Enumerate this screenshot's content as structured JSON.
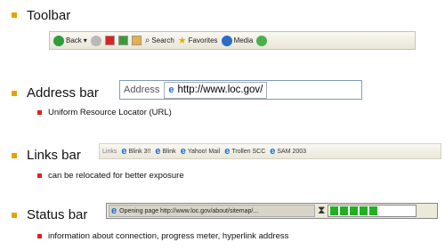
{
  "toolbar": {
    "heading": "Toolbar",
    "back_label": "Back",
    "search_label": "Search",
    "favorites_label": "Favorites",
    "media_label": "Media"
  },
  "address": {
    "heading": "Address bar",
    "label": "Address",
    "url": "http://www.loc.gov/",
    "description": "Uniform Resource Locator (URL)"
  },
  "links": {
    "heading": "Links bar",
    "label": "Links",
    "items": [
      "Blink 3!!",
      "Blink",
      "Yahoo! Mail",
      "Trollen SCC",
      "SAM 2003"
    ],
    "description": "can be relocated for better exposure"
  },
  "status": {
    "heading": "Status bar",
    "text": "Opening page http://www.loc.gov/about/sitemap/...",
    "progress": 0.45,
    "description": "information about connection, progress meter, hyperlink address"
  }
}
